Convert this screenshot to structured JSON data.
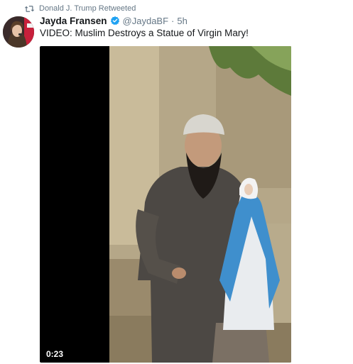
{
  "retweet": {
    "label": "Donald J. Trump Retweeted",
    "icon": "retweet-icon"
  },
  "tweet": {
    "display_name": "Jayda Fransen",
    "verified_icon": "verified-badge-icon",
    "handle": "@JaydaBF",
    "separator": "·",
    "time": "5h",
    "text": "VIDEO: Muslim Destroys a Statue of Virgin Mary!"
  },
  "media": {
    "duration": "0:23"
  },
  "colors": {
    "secondary_text": "#657786",
    "verified_blue": "#1da1f2",
    "video_background": "#000000"
  }
}
